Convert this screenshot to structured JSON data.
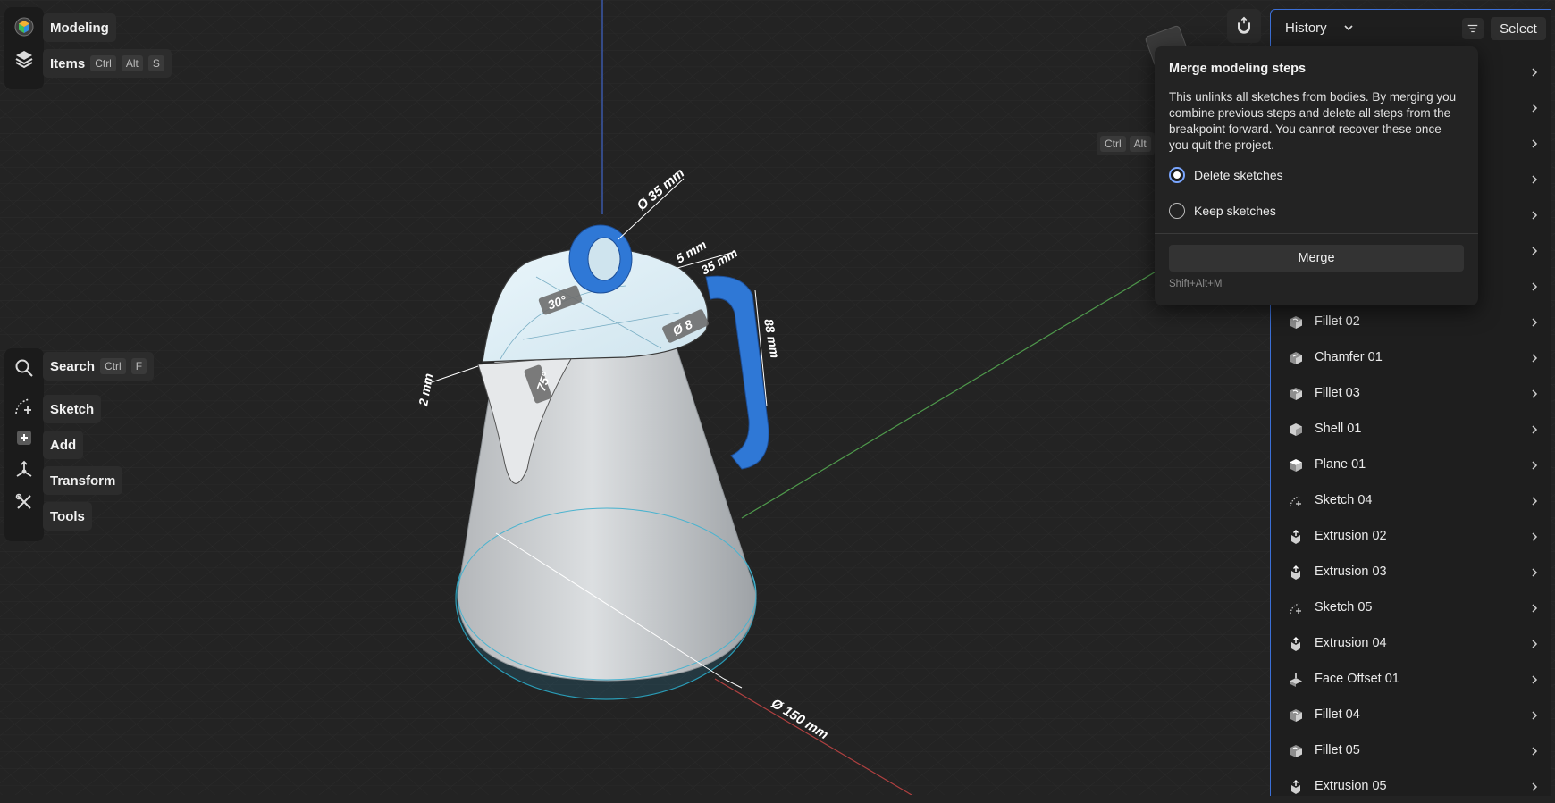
{
  "toolbar_top": {
    "modeling_label": "Modeling",
    "items_label": "Items",
    "items_keys": [
      "Ctrl",
      "Alt",
      "S"
    ]
  },
  "toolbar_left": {
    "search_label": "Search",
    "search_keys": [
      "Ctrl",
      "F"
    ],
    "sketch_label": "Sketch",
    "add_label": "Add",
    "transform_label": "Transform",
    "tools_label": "Tools"
  },
  "viewport_hint": {
    "keys": [
      "Ctrl",
      "Alt"
    ]
  },
  "dimensions": {
    "ring_diameter": "Ø 35 mm",
    "base_diameter": "Ø 150 mm",
    "angle_top": "30°",
    "spout_angle": "75°",
    "spout_thickness": "2 mm",
    "lid_offset": "5 mm",
    "handle_top": "35 mm",
    "handle_height": "88 mm",
    "lid_hole": "Ø 8"
  },
  "history": {
    "title": "History",
    "select_label": "Select",
    "items": [
      {
        "label": "",
        "icon": "sketch-icon"
      },
      {
        "label": "",
        "icon": "sketch-icon"
      },
      {
        "label": "",
        "icon": "sketch-icon"
      },
      {
        "label": "",
        "icon": "sketch-icon"
      },
      {
        "label": "",
        "icon": "sketch-icon"
      },
      {
        "label": "",
        "icon": "sketch-icon"
      },
      {
        "label": "",
        "icon": "sketch-icon"
      },
      {
        "label": "Fillet 02",
        "icon": "fillet-icon"
      },
      {
        "label": "Chamfer 01",
        "icon": "chamfer-icon"
      },
      {
        "label": "Fillet 03",
        "icon": "fillet-icon"
      },
      {
        "label": "Shell 01",
        "icon": "shell-icon"
      },
      {
        "label": "Plane 01",
        "icon": "plane-icon"
      },
      {
        "label": "Sketch 04",
        "icon": "sketch-icon"
      },
      {
        "label": "Extrusion 02",
        "icon": "extrusion-icon"
      },
      {
        "label": "Extrusion 03",
        "icon": "extrusion-icon"
      },
      {
        "label": "Sketch 05",
        "icon": "sketch-icon"
      },
      {
        "label": "Extrusion 04",
        "icon": "extrusion-icon"
      },
      {
        "label": "Face Offset 01",
        "icon": "face-offset-icon"
      },
      {
        "label": "Fillet 04",
        "icon": "fillet-icon"
      },
      {
        "label": "Fillet 05",
        "icon": "fillet-icon"
      },
      {
        "label": "Extrusion 05",
        "icon": "extrusion-icon"
      }
    ]
  },
  "merge_popover": {
    "title": "Merge modeling steps",
    "description": "This unlinks all sketches from bodies. By merging you combine previous steps and delete all steps from the breakpoint forward. You cannot recover these once you quit the project.",
    "options": [
      {
        "label": "Delete sketches",
        "selected": true
      },
      {
        "label": "Keep sketches",
        "selected": false
      }
    ],
    "button_label": "Merge",
    "shortcut": "Shift+Alt+M"
  },
  "colors": {
    "accent": "#3b6fd6",
    "part_blue": "#2f78d6",
    "body_grey": "#c8cbce",
    "background": "#232323"
  }
}
